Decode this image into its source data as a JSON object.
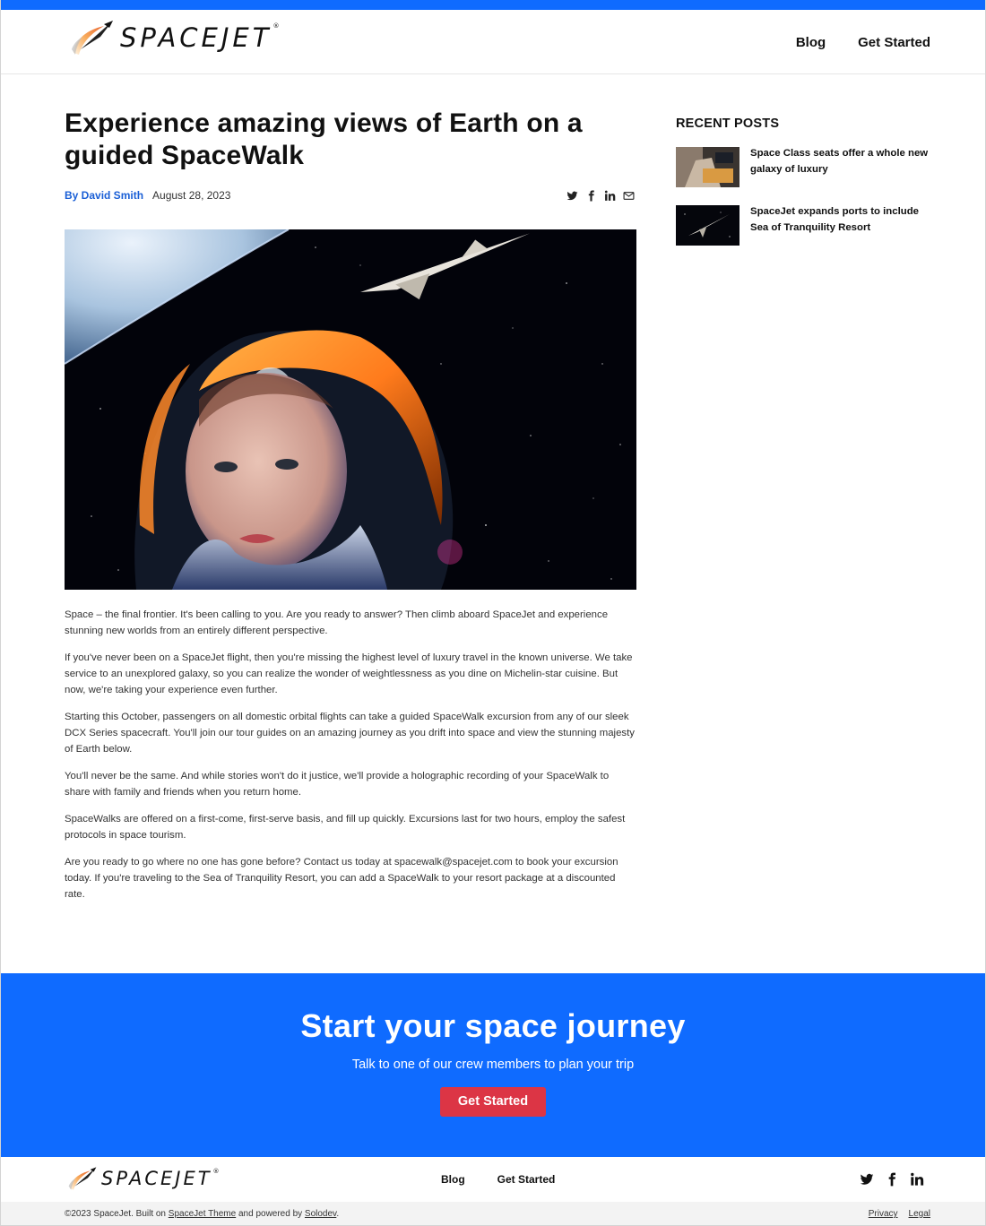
{
  "brand": {
    "name": "SPACEJET",
    "reg": "®"
  },
  "nav": {
    "blog": "Blog",
    "get_started": "Get Started"
  },
  "article": {
    "title": "Experience amazing views of Earth on a guided SpaceWalk",
    "author": "By David Smith",
    "date": "August 28, 2023",
    "share_icons": [
      "twitter-icon",
      "facebook-icon",
      "linkedin-icon",
      "email-icon"
    ],
    "paragraphs": [
      "Space – the final frontier. It's been calling to you. Are you ready to answer? Then climb aboard SpaceJet and experience stunning new worlds from an entirely different perspective.",
      "If you've never been on a SpaceJet flight, then you're missing the highest level of luxury travel in the known universe. We take service to an unexplored galaxy, so you can realize the wonder of weightlessness as you dine on Michelin-star cuisine. But now, we're taking your experience even further.",
      "Starting this October, passengers on all domestic orbital flights can take a guided SpaceWalk excursion from any of our sleek DCX Series spacecraft. You'll join our tour guides on an amazing journey as you drift into space and view the stunning majesty of Earth below.",
      "You'll never be the same. And while stories won't do it justice, we'll provide a holographic recording of your SpaceWalk to share with family and friends when you return home.",
      "SpaceWalks are offered on a first-come, first-serve basis, and fill up quickly. Excursions last for two hours, employ the safest protocols in space tourism.",
      "Are you ready to go where no one has gone before? Contact us today at spacewalk@spacejet.com to book your excursion today. If you're traveling to the Sea of Tranquility Resort, you can add a SpaceWalk to your resort package at a discounted rate."
    ]
  },
  "sidebar": {
    "heading": "RECENT POSTS",
    "posts": [
      {
        "title": "Space Class seats offer a whole new galaxy of luxury"
      },
      {
        "title": "SpaceJet expands ports to include Sea of Tranquility Resort"
      }
    ]
  },
  "cta": {
    "heading": "Start your space journey",
    "subheading": "Talk to one of our crew members to plan your trip",
    "button": "Get Started"
  },
  "footer": {
    "blog": "Blog",
    "get_started": "Get Started",
    "social_icons": [
      "twitter-icon",
      "facebook-icon",
      "linkedin-icon"
    ],
    "copyright_prefix": "©2023 SpaceJet. Built on ",
    "theme_link": "SpaceJet Theme",
    "copyright_mid": " and powered by ",
    "solodev_link": "Solodev",
    "copyright_suffix": ".",
    "privacy": "Privacy",
    "legal": "Legal"
  },
  "colors": {
    "primary": "#0f6bff",
    "cta_button": "#dc3545",
    "author_link": "#1a5fd6"
  }
}
